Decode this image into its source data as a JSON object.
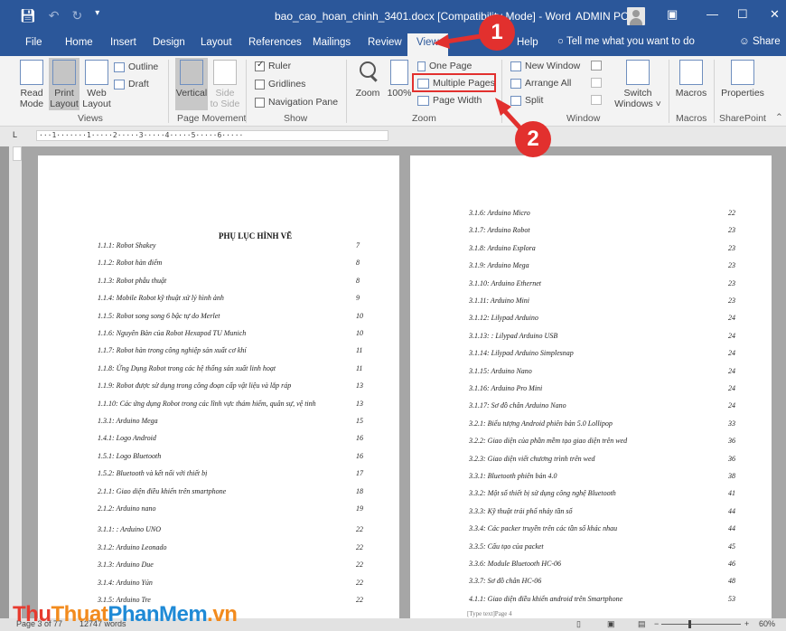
{
  "titlebar": {
    "title": "bao_cao_hoan_chinh_3401.docx [Compatibility Mode] - Word",
    "account": "ADMIN PC",
    "save_icon": "save-icon",
    "undo_icon": "undo-icon",
    "redo_icon": "redo-icon"
  },
  "tabs": [
    "File",
    "Home",
    "Insert",
    "Design",
    "Layout",
    "References",
    "Mailings",
    "Review",
    "View",
    "Help"
  ],
  "tellme": "Tell me what you want to do",
  "share": "Share",
  "ribbon": {
    "views": {
      "read_mode": [
        "Read",
        "Mode"
      ],
      "print_layout": [
        "Print",
        "Layout"
      ],
      "web_layout": [
        "Web",
        "Layout"
      ],
      "outline": "Outline",
      "draft": "Draft",
      "label": "Views"
    },
    "page_movement": {
      "vertical": "Vertical",
      "side_to_side": [
        "Side",
        "to Side"
      ],
      "label": "Page Movement"
    },
    "show": {
      "ruler": "Ruler",
      "gridlines": "Gridlines",
      "navigation_pane": "Navigation Pane",
      "label": "Show"
    },
    "zoom": {
      "zoom": "Zoom",
      "hundred": "100%",
      "one_page": "One Page",
      "multiple_pages": "Multiple Pages",
      "page_width": "Page Width",
      "label": "Zoom"
    },
    "window": {
      "new_window": "New Window",
      "arrange_all": "Arrange All",
      "split": "Split",
      "switch_windows": [
        "Switch",
        "Windows ˅"
      ],
      "label": "Window"
    },
    "macros": {
      "button": "Macros",
      "label": "Macros"
    },
    "sharepoint": {
      "button": "Properties",
      "label": "SharePoint"
    }
  },
  "ruler_text": "···1·······1·····2·····3·····4·····5·····6·····",
  "doc": {
    "left_title": "PHỤ LỤC HÌNH VẼ",
    "left_entries": [
      {
        "t": "1.1.1: Robot Shakey",
        "p": "7"
      },
      {
        "t": "1.1.2: Robot hàn điểm",
        "p": "8"
      },
      {
        "t": "1.1.3: Robot phẫu thuật",
        "p": "8"
      },
      {
        "t": "1.1.4: Mobile Robot kỹ thuật xử lý hình ảnh",
        "p": "9"
      },
      {
        "t": "1.1.5: Robot song song 6 bậc tự do Merlet",
        "p": "10"
      },
      {
        "t": "1.1.6: Nguyên Bản của Robot Hexapod TU Munich",
        "p": "10"
      },
      {
        "t": "1.1.7: Robot hàn trong công nghiệp sản xuất cơ khí",
        "p": "11"
      },
      {
        "t": "1.1.8: Ứng Dụng Robot trong các hệ thống sản xuất linh hoạt",
        "p": "11"
      },
      {
        "t": "1.1.9: Robot được sử dụng trong công đoạn cấp vật liệu và lắp ráp",
        "p": "13"
      },
      {
        "t": "1.1.10: Các ứng dụng Robot trong các lĩnh vực thám hiểm, quân sự, vệ tinh",
        "p": "13"
      },
      {
        "t": "1.3.1: Arduino Mega",
        "p": "15"
      },
      {
        "t": "1.4.1: Logo Android",
        "p": "16"
      },
      {
        "t": "1.5.1: Logo Bluetooth",
        "p": "16"
      },
      {
        "t": "1.5.2: Bluetooth và kết nối với thiết bị",
        "p": "17"
      },
      {
        "t": "2.1.1: Giao diện điều khiển trên smartphone",
        "p": "18"
      },
      {
        "t": "2.1.2: Arduino nano",
        "p": "19"
      },
      {
        "t": "3.1.1: : Arduino UNO",
        "p": "22"
      },
      {
        "t": "3.1.2: Arduino Leonado",
        "p": "22"
      },
      {
        "t": "3.1.3: Arduino Due",
        "p": "22"
      },
      {
        "t": "3.1.4: Arduino Yún",
        "p": "22"
      },
      {
        "t": "3.1.5: Arduino Tre",
        "p": "22"
      }
    ],
    "right_entries": [
      {
        "t": "3.1.6: Arduino Micro",
        "p": "22"
      },
      {
        "t": "3.1.7: Arduino Robot",
        "p": "23"
      },
      {
        "t": "3.1.8: Arduino Esplora",
        "p": "23"
      },
      {
        "t": "3.1.9: Arduino Mega",
        "p": "23"
      },
      {
        "t": "3.1.10: Arduino Ethernet",
        "p": "23"
      },
      {
        "t": "3.1.11: Arduino Mini",
        "p": "23"
      },
      {
        "t": "3.1.12:   Lilypad Arduino",
        "p": "24"
      },
      {
        "t": "3.1.13: : Lilypad Arduino USB",
        "p": "24"
      },
      {
        "t": "3.1.14: Lilypad Arduino Simplesnap",
        "p": "24"
      },
      {
        "t": "3.1.15: Arduino Nano",
        "p": "24"
      },
      {
        "t": "3.1.16: Arduino Pro Mini",
        "p": "24"
      },
      {
        "t": "3.1.17: Sơ đồ chân Arduino Nano",
        "p": "24"
      },
      {
        "t": "3.2.1: Biểu tượng Android phiên bản 5.0 Lollipop",
        "p": "33"
      },
      {
        "t": "3.2.2: Giao diện của phần mềm tạo giao diện trên wed",
        "p": "36"
      },
      {
        "t": "3.2.3: Giao diện viết chương trình trên wed",
        "p": "36"
      },
      {
        "t": "3.3.1: Bluetooth phiên bản 4.0",
        "p": "38"
      },
      {
        "t": "3.3.2: Một số thiết bị sử dụng công nghệ Bluetooth",
        "p": "41"
      },
      {
        "t": "3.3.3:  Kỹ thuật trải phổ nhảy tần số",
        "p": "44"
      },
      {
        "t": "3.3.4: Các packer truyền trên các tần số khác nhau",
        "p": "44"
      },
      {
        "t": "3.3.5: Cấu tạo của packet",
        "p": "45"
      },
      {
        "t": "3.3.6: Module Bluetooth HC-06",
        "p": "46"
      },
      {
        "t": "3.3.7: Sơ đồ chân HC-06",
        "p": "48"
      },
      {
        "t": "4.1.1: Giao diện điều khiển android trên Smartphone",
        "p": "53"
      }
    ],
    "right_footer": "[Type text]Page 4"
  },
  "status": {
    "page": "Page 3 of 77",
    "words": "12747 words",
    "zoom": "60%"
  },
  "watermark": {
    "part1": "Thu",
    "part2": "Thuat",
    "part3": "PhanMem",
    "part4": ".vn"
  },
  "callouts": {
    "one": "1",
    "two": "2"
  },
  "colors": {
    "brand": "#2b579a",
    "callout": "#e2302e"
  }
}
